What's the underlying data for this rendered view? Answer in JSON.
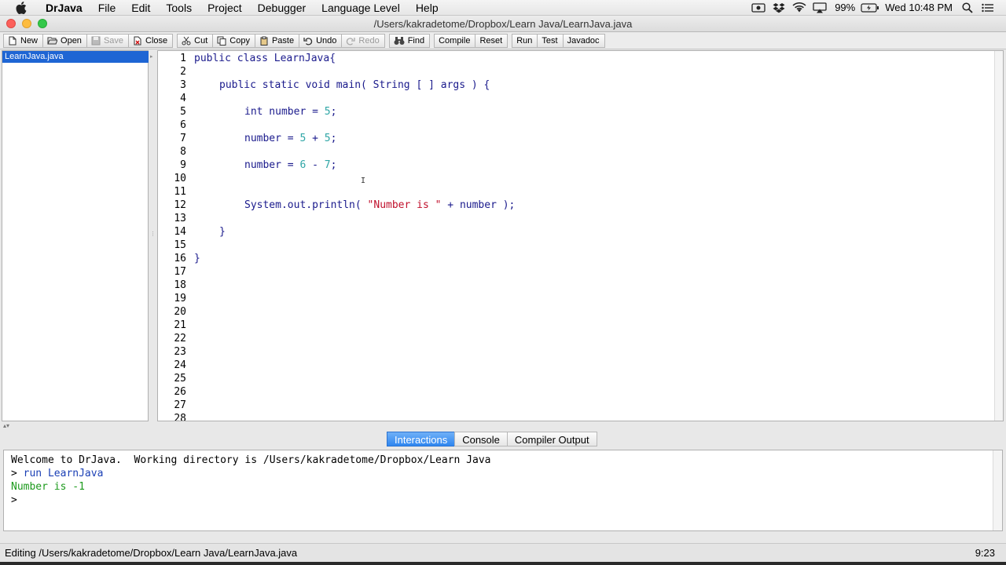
{
  "menubar": {
    "app_name": "DrJava",
    "items": [
      "File",
      "Edit",
      "Tools",
      "Project",
      "Debugger",
      "Language Level",
      "Help"
    ],
    "battery": "99%",
    "clock": "Wed 10:48 PM"
  },
  "window": {
    "title": "/Users/kakradetome/Dropbox/Learn Java/LearnJava.java"
  },
  "toolbar": {
    "new": "New",
    "open": "Open",
    "save": "Save",
    "close": "Close",
    "cut": "Cut",
    "copy": "Copy",
    "paste": "Paste",
    "undo": "Undo",
    "redo": "Redo",
    "find": "Find",
    "compile": "Compile",
    "reset": "Reset",
    "run": "Run",
    "test": "Test",
    "javadoc": "Javadoc"
  },
  "files": [
    "LearnJava.java"
  ],
  "editor": {
    "line_numbers": [
      "1",
      "2",
      "3",
      "4",
      "5",
      "6",
      "7",
      "8",
      "9",
      "10",
      "11",
      "12",
      "13",
      "14",
      "15",
      "16",
      "17",
      "18",
      "19",
      "20",
      "21",
      "22",
      "23",
      "24",
      "25",
      "26",
      "27",
      "28"
    ],
    "lines": {
      "l1_kw": "public class",
      "l1_rest": " LearnJava{",
      "l3_kw": "public static void",
      "l3_rest": " main( String [ ] args ) {",
      "l5_kw": "int",
      "l5_a": " number = ",
      "l5_n": "5",
      "l5_end": ";",
      "l7_a": "number = ",
      "l7_n1": "5",
      "l7_op": " + ",
      "l7_n2": "5",
      "l7_end": ";",
      "l9_a": "number = ",
      "l9_n1": "6",
      "l9_op": " - ",
      "l9_n2": "7",
      "l9_end": ";",
      "l12_a": "System.out.println( ",
      "l12_s": "\"Number is \"",
      "l12_b": " + number );",
      "l14": "}",
      "l16": "}"
    }
  },
  "tabs": {
    "interactions": "Interactions",
    "console": "Console",
    "compiler_output": "Compiler Output"
  },
  "console": {
    "welcome": "Welcome to DrJava.  Working directory is /Users/kakradetome/Dropbox/Learn Java",
    "cmd_prompt": "> ",
    "cmd": "run LearnJava",
    "output": "Number is -1",
    "prompt": ">"
  },
  "status": {
    "editing": "Editing /Users/kakradetome/Dropbox/Learn Java/LearnJava.java",
    "position": "9:23"
  }
}
